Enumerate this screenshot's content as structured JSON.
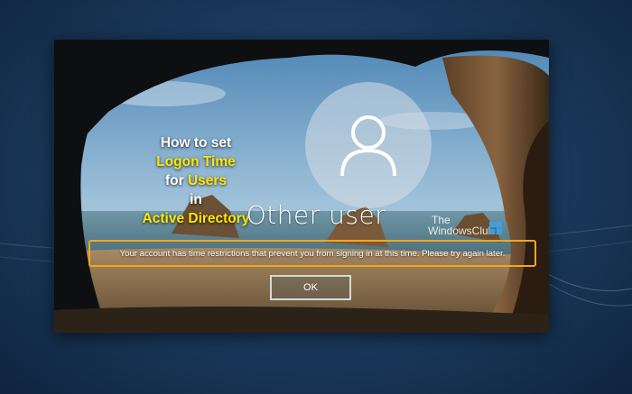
{
  "caption": {
    "line1": "How to set",
    "line2": "Logon Time",
    "line3_prefix": "for",
    "line3_highlight": "Users",
    "line4": "in",
    "line5": "Active Directory"
  },
  "watermark": {
    "line1": "The",
    "line2": "WindowsClub"
  },
  "login": {
    "username": "Other user",
    "message": "Your account has time restrictions that prevent you from signing in at this time. Please try again later.",
    "ok_label": "OK"
  },
  "colors": {
    "highlight_text": "#ffe600",
    "message_border": "#f4a71c",
    "page_background": "#1d3d61"
  },
  "icons": {
    "avatar": "user-silhouette-icon",
    "watermark_logo": "windows-logo-icon"
  }
}
